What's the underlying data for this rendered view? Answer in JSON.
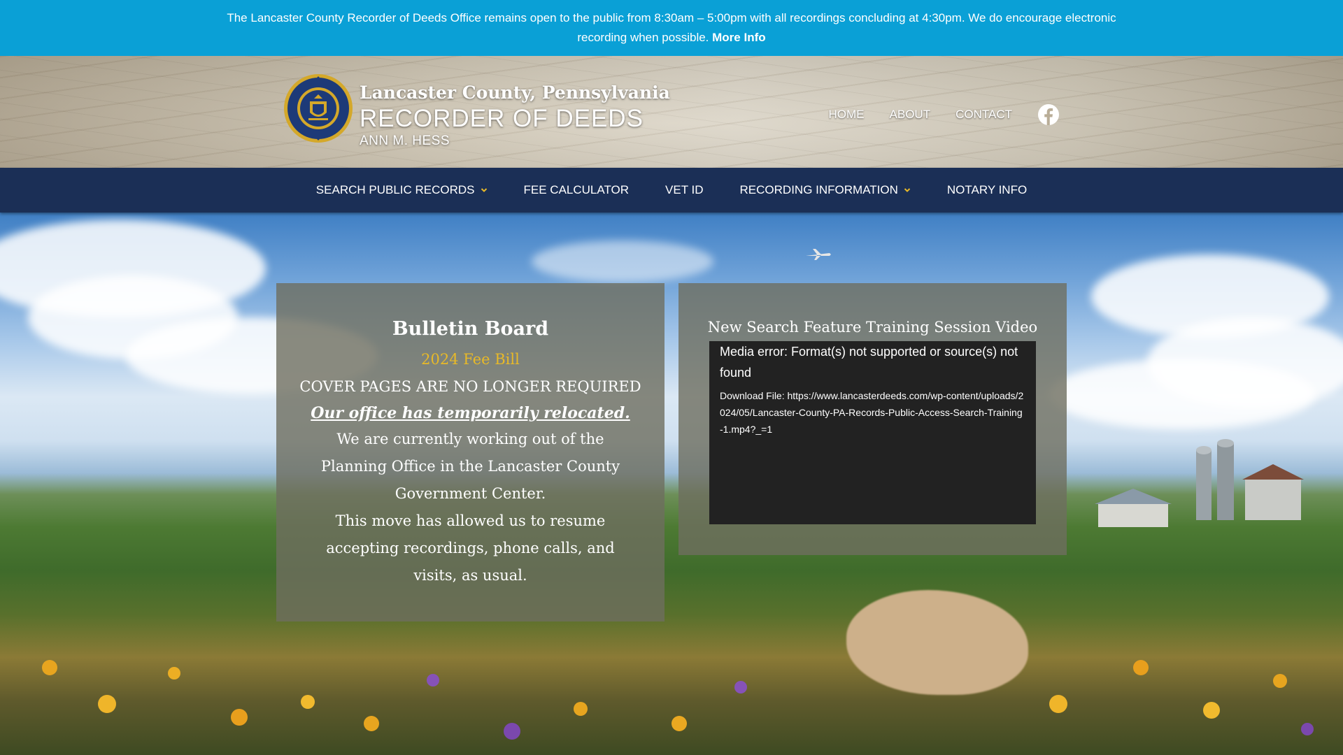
{
  "notice": {
    "text": "The Lancaster County Recorder of Deeds Office remains open to the public from 8:30am – 5:00pm with all recordings concluding at 4:30pm. We do encourage electronic recording when possible.",
    "link": "More Info"
  },
  "header": {
    "seal_text": "RECORDER OF DEEDS · LANCASTER COUNTY, PA",
    "county": "Lancaster County, Pennsylvania",
    "office": "RECORDER OF DEEDS",
    "person": "ANN M. HESS",
    "links": [
      "HOME",
      "ABOUT",
      "CONTACT"
    ],
    "social_icon": "facebook-icon"
  },
  "main_nav": {
    "items": [
      {
        "label": "SEARCH PUBLIC RECORDS",
        "dropdown": true
      },
      {
        "label": "FEE CALCULATOR",
        "dropdown": false
      },
      {
        "label": "VET ID",
        "dropdown": false
      },
      {
        "label": "RECORDING INFORMATION",
        "dropdown": true
      },
      {
        "label": "NOTARY INFO",
        "dropdown": false
      }
    ],
    "chevron_color": "#e8b928"
  },
  "bulletin": {
    "title": "Bulletin Board",
    "fee_link": "2024 Fee Bill",
    "cover": "COVER PAGES ARE NO LONGER REQUIRED",
    "relocated": "Our office has temporarily relocated.",
    "p1": "We are currently working out of the Planning Office in the Lancaster County Government Center.",
    "p2": "This move has allowed us to resume accepting recordings, phone calls, and visits, as usual."
  },
  "video": {
    "title": "New Search Feature Training Session Video",
    "error": "Media error: Format(s) not supported or source(s) not found",
    "download": "Download File: https://www.lancasterdeeds.com/wp-content/uploads/2024/05/Lancaster-County-PA-Records-Public-Access-Search-Training-1.mp4?_=1"
  },
  "colors": {
    "notice_bg": "#0aa0d6",
    "nav_bg": "#1b2f56",
    "accent_gold": "#e8b928"
  }
}
